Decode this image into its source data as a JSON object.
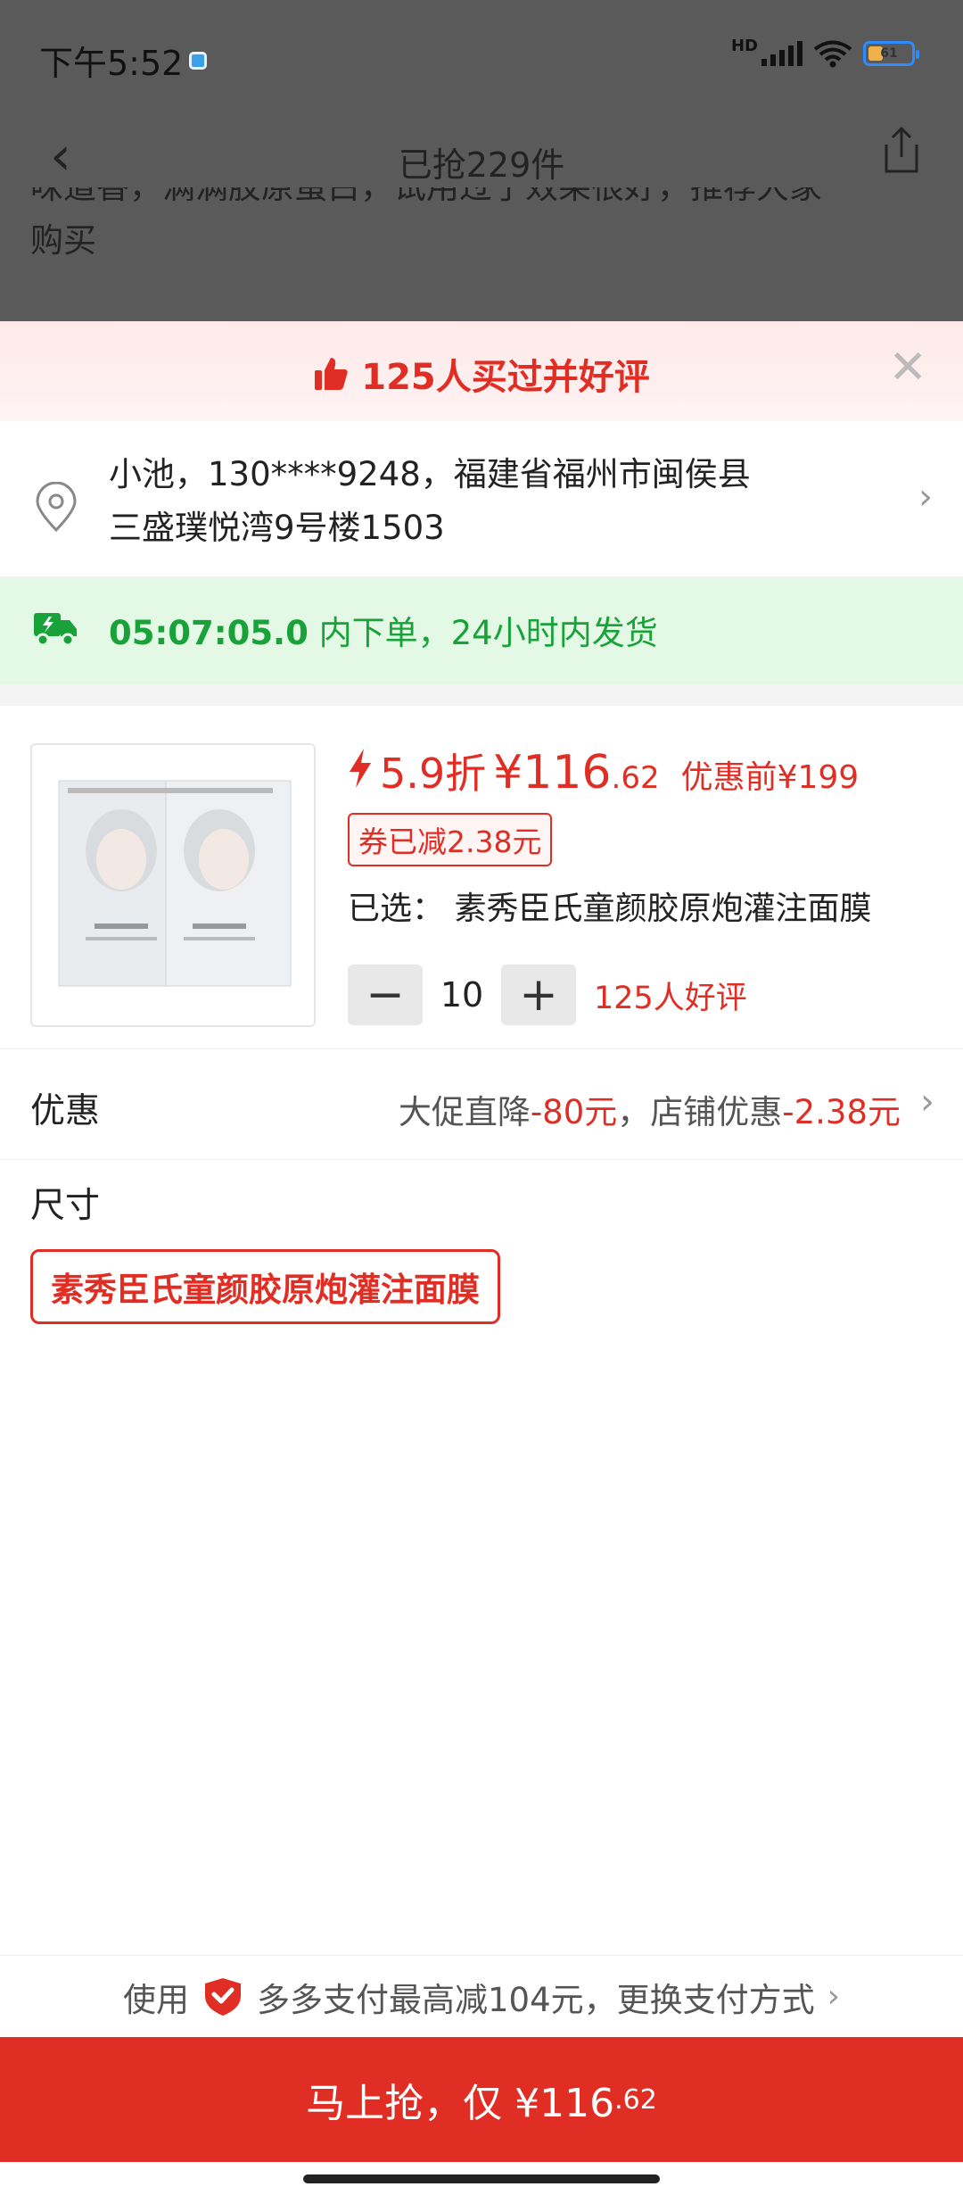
{
  "status_bar": {
    "time": "下午5:52",
    "network": "HD",
    "battery": "61"
  },
  "nav": {
    "title": "已抢229件"
  },
  "background_review": {
    "line1": "味道香，满满胶原蛋白，试用过了效果很好，推荐大家",
    "line2": "购买"
  },
  "banner": {
    "text": "125人买过并好评"
  },
  "address": {
    "line1": "小池，130****9248，福建省福州市闽侯县",
    "line2": "三盛璞悦湾9号楼1503"
  },
  "shipping": {
    "countdown": "05:07:05.0",
    "text": " 内下单，24小时内发货"
  },
  "product": {
    "discount": "5.9折",
    "yen": "¥",
    "price_int": "116",
    "price_dec": ".62",
    "original_price": "优惠前¥199",
    "coupon": "券已减2.38元",
    "selected_label": "已选：",
    "selected_value": "素秀臣氏童颜胶原炮灌注面膜",
    "quantity": "10",
    "reviews": "125人好评"
  },
  "discounts": {
    "label": "优惠",
    "part1": "大促直降",
    "amt1": "-80元",
    "sep": "，店铺优惠",
    "amt2": "-2.38元"
  },
  "size": {
    "label": "尺寸",
    "option": "素秀臣氏童颜胶原炮灌注面膜"
  },
  "payment": {
    "prefix": "使用",
    "text": "多多支付最高减104元，更换支付方式"
  },
  "buy_button": {
    "label": "马上抢，仅 ¥116",
    "dec": ".62"
  },
  "colors": {
    "accent": "#e02e24",
    "green": "#19a23a"
  },
  "icons": [
    "thumbs-up-icon",
    "close-icon",
    "location-pin-icon",
    "chevron-right-icon",
    "truck-icon",
    "lightning-icon",
    "minus-icon",
    "plus-icon",
    "shield-heart-icon",
    "back-icon",
    "share-icon"
  ]
}
